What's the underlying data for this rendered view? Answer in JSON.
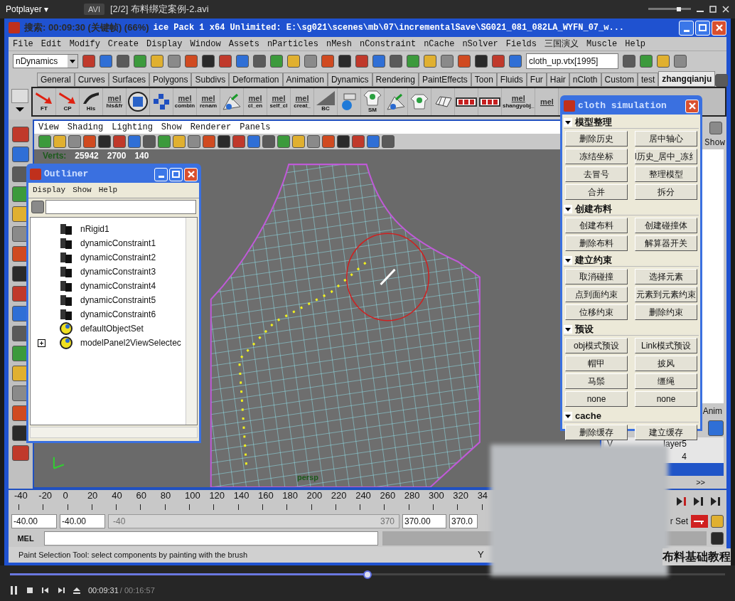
{
  "player": {
    "menu": "Potplayer ▾",
    "format": "AVI",
    "file": "[2/2] 布料绑定案例-2.avi"
  },
  "osd": "搜索: 00:09:30 (关键帧) (66%)",
  "maya_title": "ice Pack 1 x64 Unlimited: E:\\sg021\\scenes\\mb\\07\\incrementalSave\\SG021_081_082LA_WYFN_07_w...",
  "menu": [
    "File",
    "Edit",
    "Modify",
    "Create",
    "Display",
    "Window",
    "Assets",
    "nParticles",
    "nMesh",
    "nConstraint",
    "nCache",
    "nSolver",
    "Fields",
    "三国演义",
    "Muscle",
    "Help"
  ],
  "status_line": {
    "menu_set": "nDynamics",
    "selection_field": "cloth_up.vtx[1995]"
  },
  "shelf_tabs": [
    {
      "label": "General",
      "selected": false
    },
    {
      "label": "Curves",
      "selected": false
    },
    {
      "label": "Surfaces",
      "selected": false
    },
    {
      "label": "Polygons",
      "selected": false
    },
    {
      "label": "Subdivs",
      "selected": false
    },
    {
      "label": "Deformation",
      "selected": false
    },
    {
      "label": "Animation",
      "selected": false
    },
    {
      "label": "Dynamics",
      "selected": false
    },
    {
      "label": "Rendering",
      "selected": false
    },
    {
      "label": "PaintEffects",
      "selected": false
    },
    {
      "label": "Toon",
      "selected": false
    },
    {
      "label": "Fluids",
      "selected": false
    },
    {
      "label": "Fur",
      "selected": false
    },
    {
      "label": "Hair",
      "selected": false
    },
    {
      "label": "nCloth",
      "selected": false
    },
    {
      "label": "Custom",
      "selected": false
    },
    {
      "label": "test",
      "selected": false
    },
    {
      "label": "zhangqianju",
      "selected": true
    }
  ],
  "shelf_items": [
    {
      "kind": "arrow",
      "label": "FT"
    },
    {
      "kind": "arrow",
      "label": "CP"
    },
    {
      "kind": "curve",
      "label": "His"
    },
    {
      "kind": "mel",
      "label": "his&fr"
    },
    {
      "kind": "circle"
    },
    {
      "kind": "squares"
    },
    {
      "kind": "mel",
      "label": "combin"
    },
    {
      "kind": "mel",
      "label": "renam"
    },
    {
      "kind": "tent"
    },
    {
      "kind": "mel",
      "label": "cl_en"
    },
    {
      "kind": "mel",
      "label": "self_cl"
    },
    {
      "kind": "mel",
      "label": "creat_"
    },
    {
      "kind": "slash",
      "label": "BC"
    },
    {
      "kind": "sphere"
    },
    {
      "kind": "shirt",
      "label": "SM"
    },
    {
      "kind": "tent"
    },
    {
      "kind": "shirt"
    },
    {
      "kind": "tiles"
    },
    {
      "kind": "film"
    },
    {
      "kind": "film"
    },
    {
      "kind": "mel",
      "label": "shangyobj_"
    },
    {
      "kind": "mel"
    }
  ],
  "viewport": {
    "menu": [
      "View",
      "Shading",
      "Lighting",
      "Show",
      "Renderer",
      "Panels"
    ],
    "hud_label": "Verts:",
    "hud_values": [
      "25942",
      "2700",
      "140"
    ],
    "camera": "persp"
  },
  "channel_box": {
    "show": "Show",
    "anim_tab": "Anim",
    "layer_flag": "V",
    "layers": [
      "layer5",
      "4"
    ],
    "more": ">>"
  },
  "outliner": {
    "title": "Outliner",
    "menu": [
      "Display",
      "Show",
      "Help"
    ],
    "items": [
      {
        "name": "nRigid1",
        "kind": "node",
        "expandable": false
      },
      {
        "name": "dynamicConstraint1",
        "kind": "node",
        "expandable": false
      },
      {
        "name": "dynamicConstraint2",
        "kind": "node",
        "expandable": false
      },
      {
        "name": "dynamicConstraint3",
        "kind": "node",
        "expandable": false
      },
      {
        "name": "dynamicConstraint4",
        "kind": "node",
        "expandable": false
      },
      {
        "name": "dynamicConstraint5",
        "kind": "node",
        "expandable": false
      },
      {
        "name": "dynamicConstraint6",
        "kind": "node",
        "expandable": false
      },
      {
        "name": "defaultObjectSet",
        "kind": "set",
        "expandable": false
      },
      {
        "name": "modelPanel2ViewSelectec",
        "kind": "set",
        "expandable": true
      }
    ]
  },
  "cloth_panel": {
    "title": "cloth simulation",
    "sections": [
      {
        "title": "模型整理",
        "expanded": true,
        "buttons": [
          "删除历史",
          "居中轴心",
          "冻结坐标",
          "l历史_居中_冻纟",
          "去冒号",
          "整理模型",
          "合并",
          "拆分"
        ]
      },
      {
        "title": "创建布料",
        "expanded": true,
        "buttons": [
          "创建布料",
          "创建碰撞体",
          "删除布料",
          "解算器开关"
        ]
      },
      {
        "title": "建立约束",
        "expanded": true,
        "buttons": [
          "取消碰撞",
          "选择元素",
          "点到面约束",
          "元素到元素约束",
          "位移约束",
          "删除约束"
        ]
      },
      {
        "title": "预设",
        "expanded": true,
        "buttons": [
          "obj模式预设",
          "Link模式预设",
          "帽甲",
          "披风",
          "马鬃",
          "缰绳",
          "none",
          "none"
        ]
      },
      {
        "title": "cache",
        "expanded": true,
        "buttons": [
          "删除缓存",
          "建立缓存"
        ]
      }
    ]
  },
  "time_slider": {
    "ticks": [
      "-40",
      "-20",
      "0",
      "20",
      "40",
      "60",
      "80",
      "100",
      "120",
      "140",
      "160",
      "180",
      "200",
      "220",
      "240",
      "260",
      "280",
      "300",
      "320",
      "34"
    ]
  },
  "range_slider": {
    "start": "-40.00",
    "playback_start": "-40.00",
    "bar_start": "-40",
    "bar_end": "370",
    "playback_end": "370.00",
    "end": "370.0",
    "char_set": "r Set",
    "level": 1
  },
  "command_line": {
    "label": "MEL"
  },
  "help_line": {
    "text": "Paint Selection Tool: select components by painting with the brush",
    "extra": "Y"
  },
  "video_caption": "布料基础教程",
  "playback": {
    "level": 0.5,
    "current": "00:09:31",
    "total": "/ 00:16:57"
  }
}
